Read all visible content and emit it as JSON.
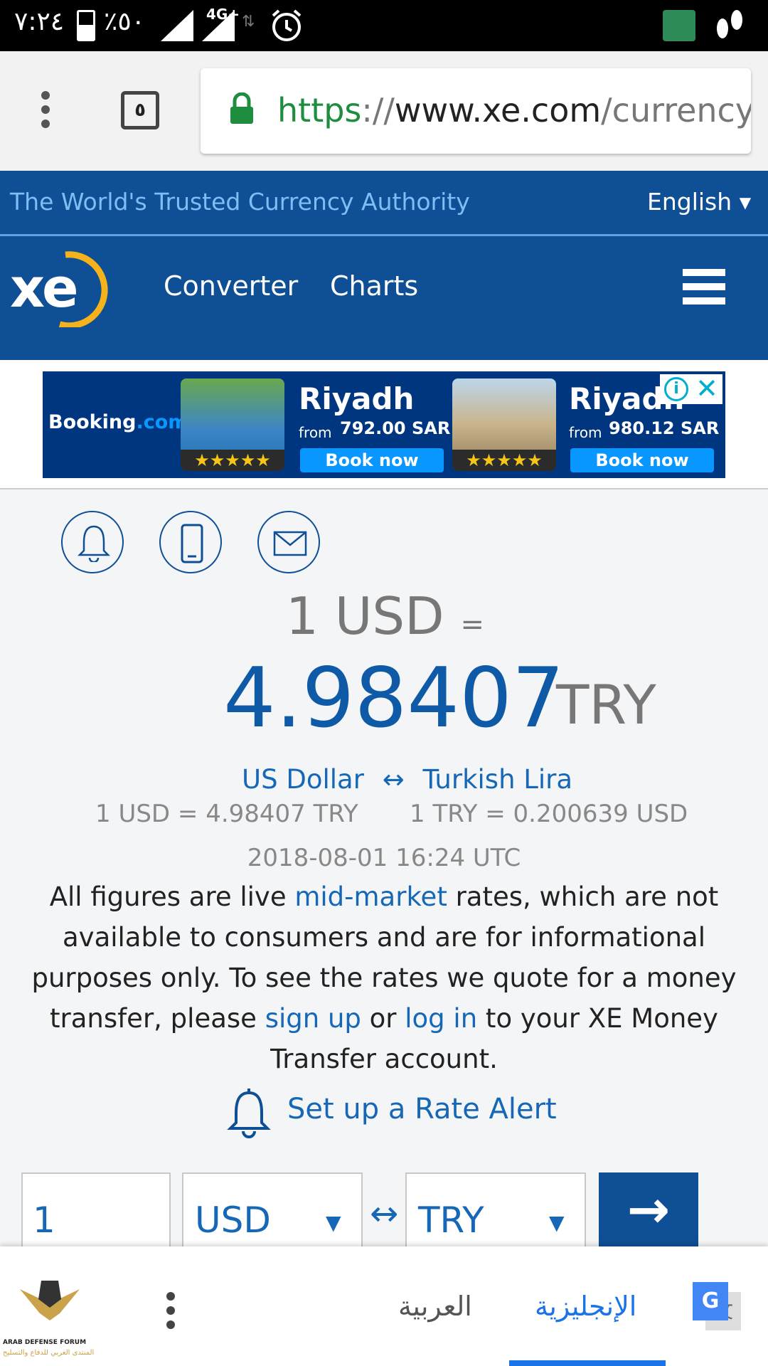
{
  "status_bar": {
    "time": "٧:٢٤",
    "battery": "٪٥٠",
    "network": "4G+"
  },
  "browser": {
    "tab_count": "٥",
    "url_scheme": "https",
    "url_sep": "://",
    "url_host": "www.xe.com",
    "url_path": "/currencyc"
  },
  "site": {
    "tagline": "The World's Trusted Currency Authority",
    "language": "English ▾",
    "logo": "xe",
    "nav": [
      "Converter",
      "Charts"
    ]
  },
  "ad": {
    "brand_a": "Booking",
    "brand_b": ".com",
    "offers": [
      {
        "city": "Riyadh",
        "from": "from",
        "price": "792.00 SAR",
        "cta": "Book now",
        "stars": "★★★★★"
      },
      {
        "city": "Riyadh",
        "from": "from",
        "price": "980.12 SAR",
        "cta": "Book now",
        "stars": "★★★★★"
      }
    ]
  },
  "rate": {
    "base": "1 USD",
    "equals": "=",
    "value": "4.98407",
    "quote": "TRY",
    "from_name": "US Dollar",
    "swap": "↔",
    "to_name": "Turkish Lira",
    "forward": "1 USD = 4.98407 TRY",
    "inverse": "1 TRY = 0.200639 USD",
    "timestamp": "2018-08-01 16:24 UTC"
  },
  "disclaimer": {
    "p1": "All figures are live ",
    "link1": "mid-market",
    "p2": " rates, which are not available to consumers and are for informational purposes only. To see the rates we quote for a money transfer, please ",
    "link2": "sign up",
    "p3": " or ",
    "link3": "log in",
    "p4": " to your XE Money Transfer account."
  },
  "rate_alert": "Set up a Rate Alert",
  "converter": {
    "amount": "1",
    "from": "USD",
    "to": "TRY",
    "swap": "↔",
    "go": "→"
  },
  "translate_bar": {
    "lang_target": "العربية",
    "lang_source": "الإنجليزية"
  },
  "watermark": {
    "line1": "ARAB DEFENSE FORUM",
    "line2": "المنتدى العربي للدفاع والتسليح"
  },
  "colors": {
    "brand_blue": "#0f4f95",
    "link_blue": "#1668b7",
    "booking_blue": "#003580"
  }
}
